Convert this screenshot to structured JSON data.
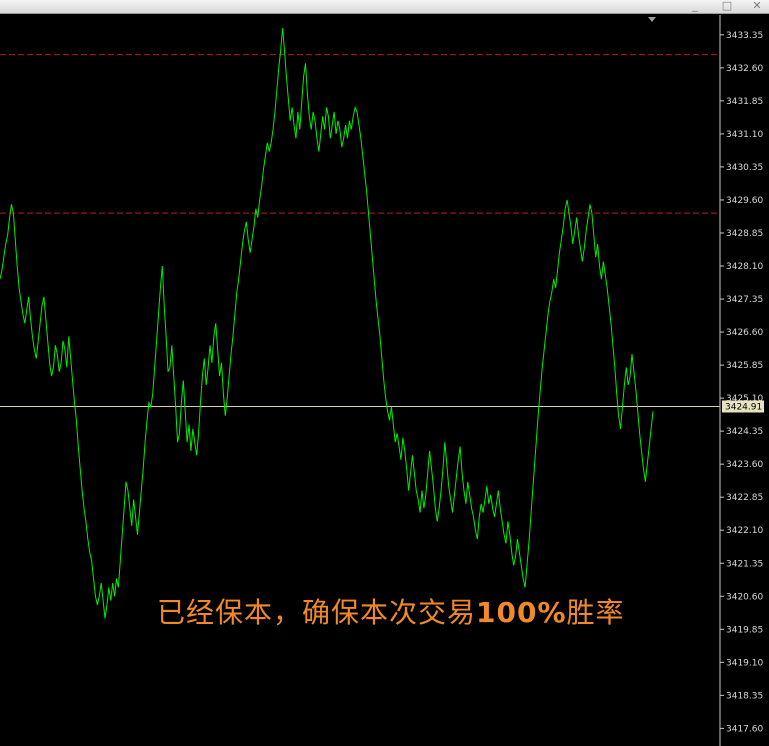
{
  "window": {
    "minimize_glyph": "_",
    "maximize_glyph": "□",
    "close_glyph": "✕"
  },
  "colors": {
    "background": "#000000",
    "price_line": "#00ee00",
    "level_line": "#b02020",
    "current_line": "#d8d0a0",
    "annotation": "#f08a28",
    "axis_text": "#d8d8d8"
  },
  "chart_data": {
    "type": "line",
    "title": "",
    "xlabel": "",
    "ylabel": "",
    "ylim": [
      3417.2,
      3433.8
    ],
    "y_ticks": [
      "3433.35",
      "3432.60",
      "3431.85",
      "3431.10",
      "3430.35",
      "3429.60",
      "3428.85",
      "3428.10",
      "3427.35",
      "3426.60",
      "3425.85",
      "3425.10",
      "3424.35",
      "3423.60",
      "3422.85",
      "3422.10",
      "3421.35",
      "3420.60",
      "3419.85",
      "3419.10",
      "3418.35",
      "3417.60"
    ],
    "horizontal_levels": [
      3432.9,
      3429.3
    ],
    "current_price": "3424.91",
    "series": [
      {
        "values": [
          3427.8,
          3428.0,
          3428.3,
          3428.6,
          3428.8,
          3429.2,
          3429.5,
          3429.3,
          3428.7,
          3428.1,
          3427.6,
          3427.3,
          3427.0,
          3426.8,
          3427.1,
          3427.4,
          3426.9,
          3426.5,
          3426.2,
          3426.0,
          3426.4,
          3426.8,
          3427.2,
          3427.4,
          3426.9,
          3426.4,
          3425.9,
          3425.6,
          3425.8,
          3426.3,
          3426.1,
          3425.7,
          3425.9,
          3426.4,
          3426.2,
          3425.8,
          3426.5,
          3426.0,
          3425.5,
          3425.0,
          3424.6,
          3424.0,
          3423.5,
          3423.0,
          3422.6,
          3422.3,
          3421.9,
          3421.6,
          3421.4,
          3421.0,
          3420.6,
          3420.4,
          3420.6,
          3420.9,
          3420.5,
          3420.1,
          3420.4,
          3420.8,
          3420.5,
          3420.9,
          3420.6,
          3421.0,
          3420.8,
          3421.4,
          3422.0,
          3422.6,
          3423.2,
          3423.0,
          3422.6,
          3422.2,
          3422.8,
          3422.4,
          3422.0,
          3422.5,
          3423.0,
          3423.5,
          3424.1,
          3424.6,
          3425.0,
          3424.9,
          3425.2,
          3425.8,
          3426.4,
          3427.0,
          3427.6,
          3428.1,
          3427.2,
          3426.5,
          3425.7,
          3425.8,
          3426.3,
          3425.6,
          3424.9,
          3424.1,
          3424.3,
          3425.0,
          3425.5,
          3424.8,
          3424.1,
          3424.5,
          3423.9,
          3424.4,
          3424.1,
          3423.8,
          3424.3,
          3425.0,
          3425.6,
          3426.0,
          3425.4,
          3425.8,
          3426.3,
          3425.9,
          3426.5,
          3426.8,
          3426.2,
          3425.6,
          3425.9,
          3425.2,
          3424.7,
          3425.1,
          3425.6,
          3426.1,
          3426.5,
          3427.0,
          3427.5,
          3427.8,
          3428.2,
          3428.6,
          3428.9,
          3429.1,
          3428.7,
          3428.4,
          3428.7,
          3429.0,
          3429.4,
          3429.2,
          3429.6,
          3429.9,
          3430.3,
          3430.6,
          3430.9,
          3430.7,
          3430.9,
          3431.2,
          3431.6,
          3432.1,
          3432.6,
          3433.0,
          3433.5,
          3433.0,
          3432.4,
          3431.9,
          3431.4,
          3431.7,
          3431.3,
          3431.0,
          3431.6,
          3431.2,
          3431.8,
          3432.4,
          3432.7,
          3432.0,
          3431.5,
          3431.2,
          3431.6,
          3431.4,
          3431.0,
          3430.7,
          3431.1,
          3431.5,
          3431.2,
          3431.7,
          3431.5,
          3431.0,
          3431.3,
          3431.6,
          3431.1,
          3431.4,
          3431.2,
          3430.8,
          3431.0,
          3431.3,
          3431.0,
          3431.4,
          3431.2,
          3431.5,
          3431.7,
          3431.6,
          3431.3,
          3431.0,
          3430.6,
          3430.2,
          3429.8,
          3429.3,
          3428.8,
          3428.3,
          3427.8,
          3427.3,
          3426.9,
          3426.5,
          3426.0,
          3425.5,
          3425.1,
          3424.8,
          3424.6,
          3424.9,
          3424.5,
          3424.1,
          3424.3,
          3424.0,
          3423.7,
          3424.2,
          3423.9,
          3423.5,
          3423.0,
          3423.4,
          3423.8,
          3423.4,
          3423.0,
          3422.8,
          3422.5,
          3423.0,
          3422.6,
          3422.9,
          3423.4,
          3423.9,
          3423.5,
          3423.1,
          3422.6,
          3422.3,
          3422.6,
          3423.0,
          3423.5,
          3424.1,
          3423.6,
          3423.1,
          3422.8,
          3422.5,
          3422.9,
          3423.3,
          3423.7,
          3424.0,
          3423.4,
          3423.0,
          3422.7,
          3423.2,
          3422.9,
          3422.6,
          3422.4,
          3422.1,
          3421.9,
          3422.4,
          3422.7,
          3422.5,
          3422.8,
          3423.1,
          3422.7,
          3422.9,
          3422.6,
          3422.4,
          3422.7,
          3423.0,
          3422.6,
          3422.3,
          3422.0,
          3421.8,
          3422.3,
          3422.0,
          3421.6,
          3421.3,
          3421.5,
          3421.9,
          3421.6,
          3421.3,
          3421.0,
          3420.8,
          3421.3,
          3421.8,
          3422.4,
          3423.0,
          3423.6,
          3424.2,
          3424.8,
          3425.3,
          3425.8,
          3426.2,
          3426.6,
          3427.0,
          3427.3,
          3427.5,
          3427.8,
          3427.6,
          3428.0,
          3428.4,
          3428.7,
          3429.0,
          3429.4,
          3429.6,
          3429.3,
          3429.0,
          3428.6,
          3428.9,
          3429.2,
          3428.8,
          3428.5,
          3428.2,
          3428.5,
          3428.9,
          3429.2,
          3429.5,
          3429.3,
          3428.8,
          3428.3,
          3428.6,
          3428.1,
          3427.8,
          3428.2,
          3427.9,
          3427.6,
          3427.2,
          3426.8,
          3426.3,
          3425.8,
          3425.2,
          3424.7,
          3424.4,
          3424.9,
          3425.4,
          3425.8,
          3425.4,
          3425.6,
          3426.1,
          3425.7,
          3425.3,
          3424.8,
          3424.3,
          3423.9,
          3423.5,
          3423.2,
          3423.6,
          3424.0,
          3424.4,
          3424.8
        ]
      }
    ]
  },
  "annotation": {
    "text_a": "已经保本，确保本次交易",
    "text_b": "100%",
    "text_c": "胜率"
  }
}
